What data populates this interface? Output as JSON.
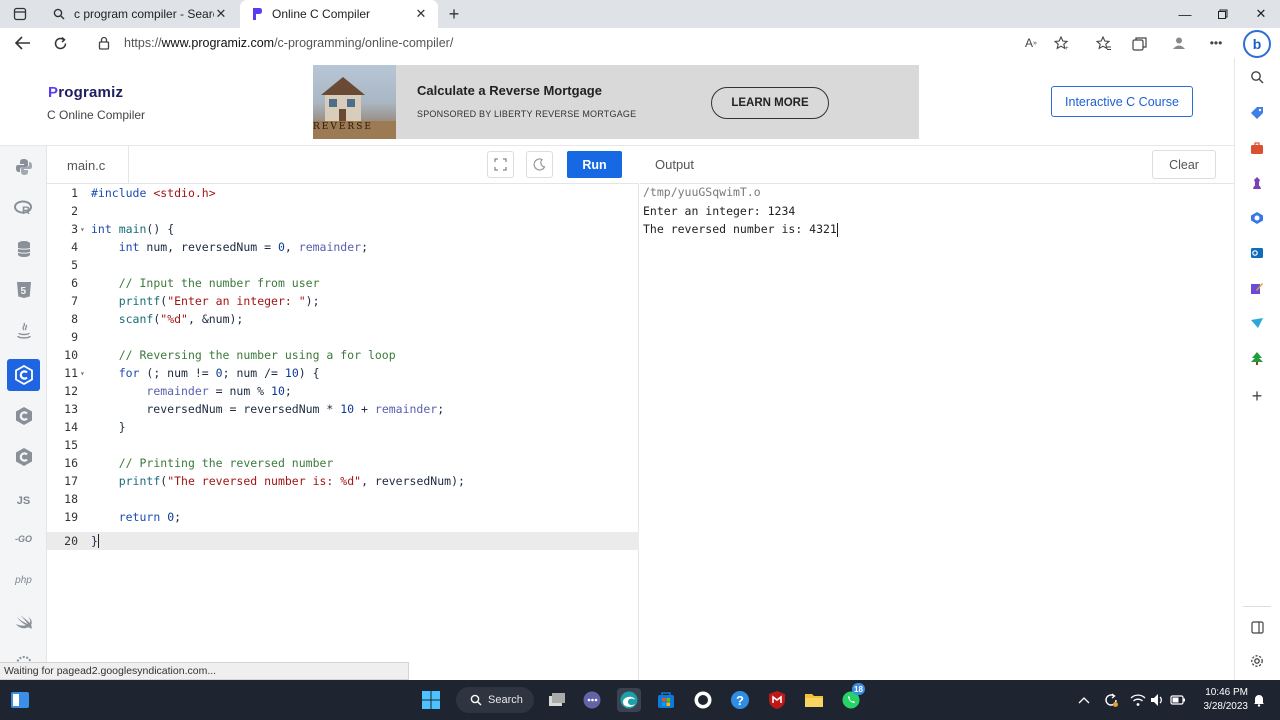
{
  "browser": {
    "tabs": [
      {
        "title": "c program compiler - Search"
      },
      {
        "title": "Online C Compiler"
      }
    ],
    "url_prefix": "https://",
    "url_host": "www.programiz.com",
    "url_path": "/c-programming/online-compiler/"
  },
  "header": {
    "logo_text": "rogramiz",
    "logo_mark": "P",
    "subtitle": "C Online Compiler",
    "ad_title": "Calculate a Reverse Mortgage",
    "ad_sponsor": "SPONSORED BY LIBERTY REVERSE MORTGAGE",
    "ad_cta": "LEARN MORE",
    "ad_image_text": "REVERSE",
    "course_button": "Interactive C Course"
  },
  "languages": [
    {
      "label": "",
      "icon": "python-icon"
    },
    {
      "label": "",
      "icon": "r-icon"
    },
    {
      "label": "",
      "icon": "sql-icon"
    },
    {
      "label": "5",
      "icon": "html5-icon"
    },
    {
      "label": "",
      "icon": "java-icon"
    },
    {
      "label": "C",
      "icon": "c-icon",
      "active": true
    },
    {
      "label": "C",
      "icon": "cpp-icon"
    },
    {
      "label": "C",
      "icon": "csharp-icon"
    },
    {
      "label": "JS",
      "icon": "javascript-icon"
    },
    {
      "label": "GO",
      "icon": "go-icon"
    },
    {
      "label": "php",
      "icon": "php-icon"
    },
    {
      "label": "",
      "icon": "swift-icon"
    }
  ],
  "editor": {
    "filename": "main.c",
    "run_label": "Run",
    "lines": [
      "#include <stdio.h>",
      "",
      "int main() {",
      "    int num, reversedNum = 0, remainder;",
      "",
      "    // Input the number from user",
      "    printf(\"Enter an integer: \");",
      "    scanf(\"%d\", &num);",
      "",
      "    // Reversing the number using a for loop",
      "    for (; num != 0; num /= 10) {",
      "        remainder = num % 10;",
      "        reversedNum = reversedNum * 10 + remainder;",
      "    }",
      "",
      "    // Printing the reversed number",
      "    printf(\"The reversed number is: %d\", reversedNum);",
      "",
      "    return 0;",
      "}"
    ],
    "fold_lines": [
      3,
      11
    ],
    "current_line": 20
  },
  "output": {
    "title": "Output",
    "clear_label": "Clear",
    "lines": [
      "/tmp/yuuGSqwimT.o",
      "Enter an integer: 1234",
      "The reversed number is: 4321"
    ]
  },
  "status_text": "Waiting for pagead2.googlesyndication.com...",
  "taskbar": {
    "search_label": "Search",
    "time": "10:46 PM",
    "date": "3/28/2023",
    "whatsapp_badge": "18"
  },
  "colors": {
    "accent": "#1668e3",
    "active_lang": "#1f64e0",
    "brand_dark": "#1c1e5e"
  }
}
